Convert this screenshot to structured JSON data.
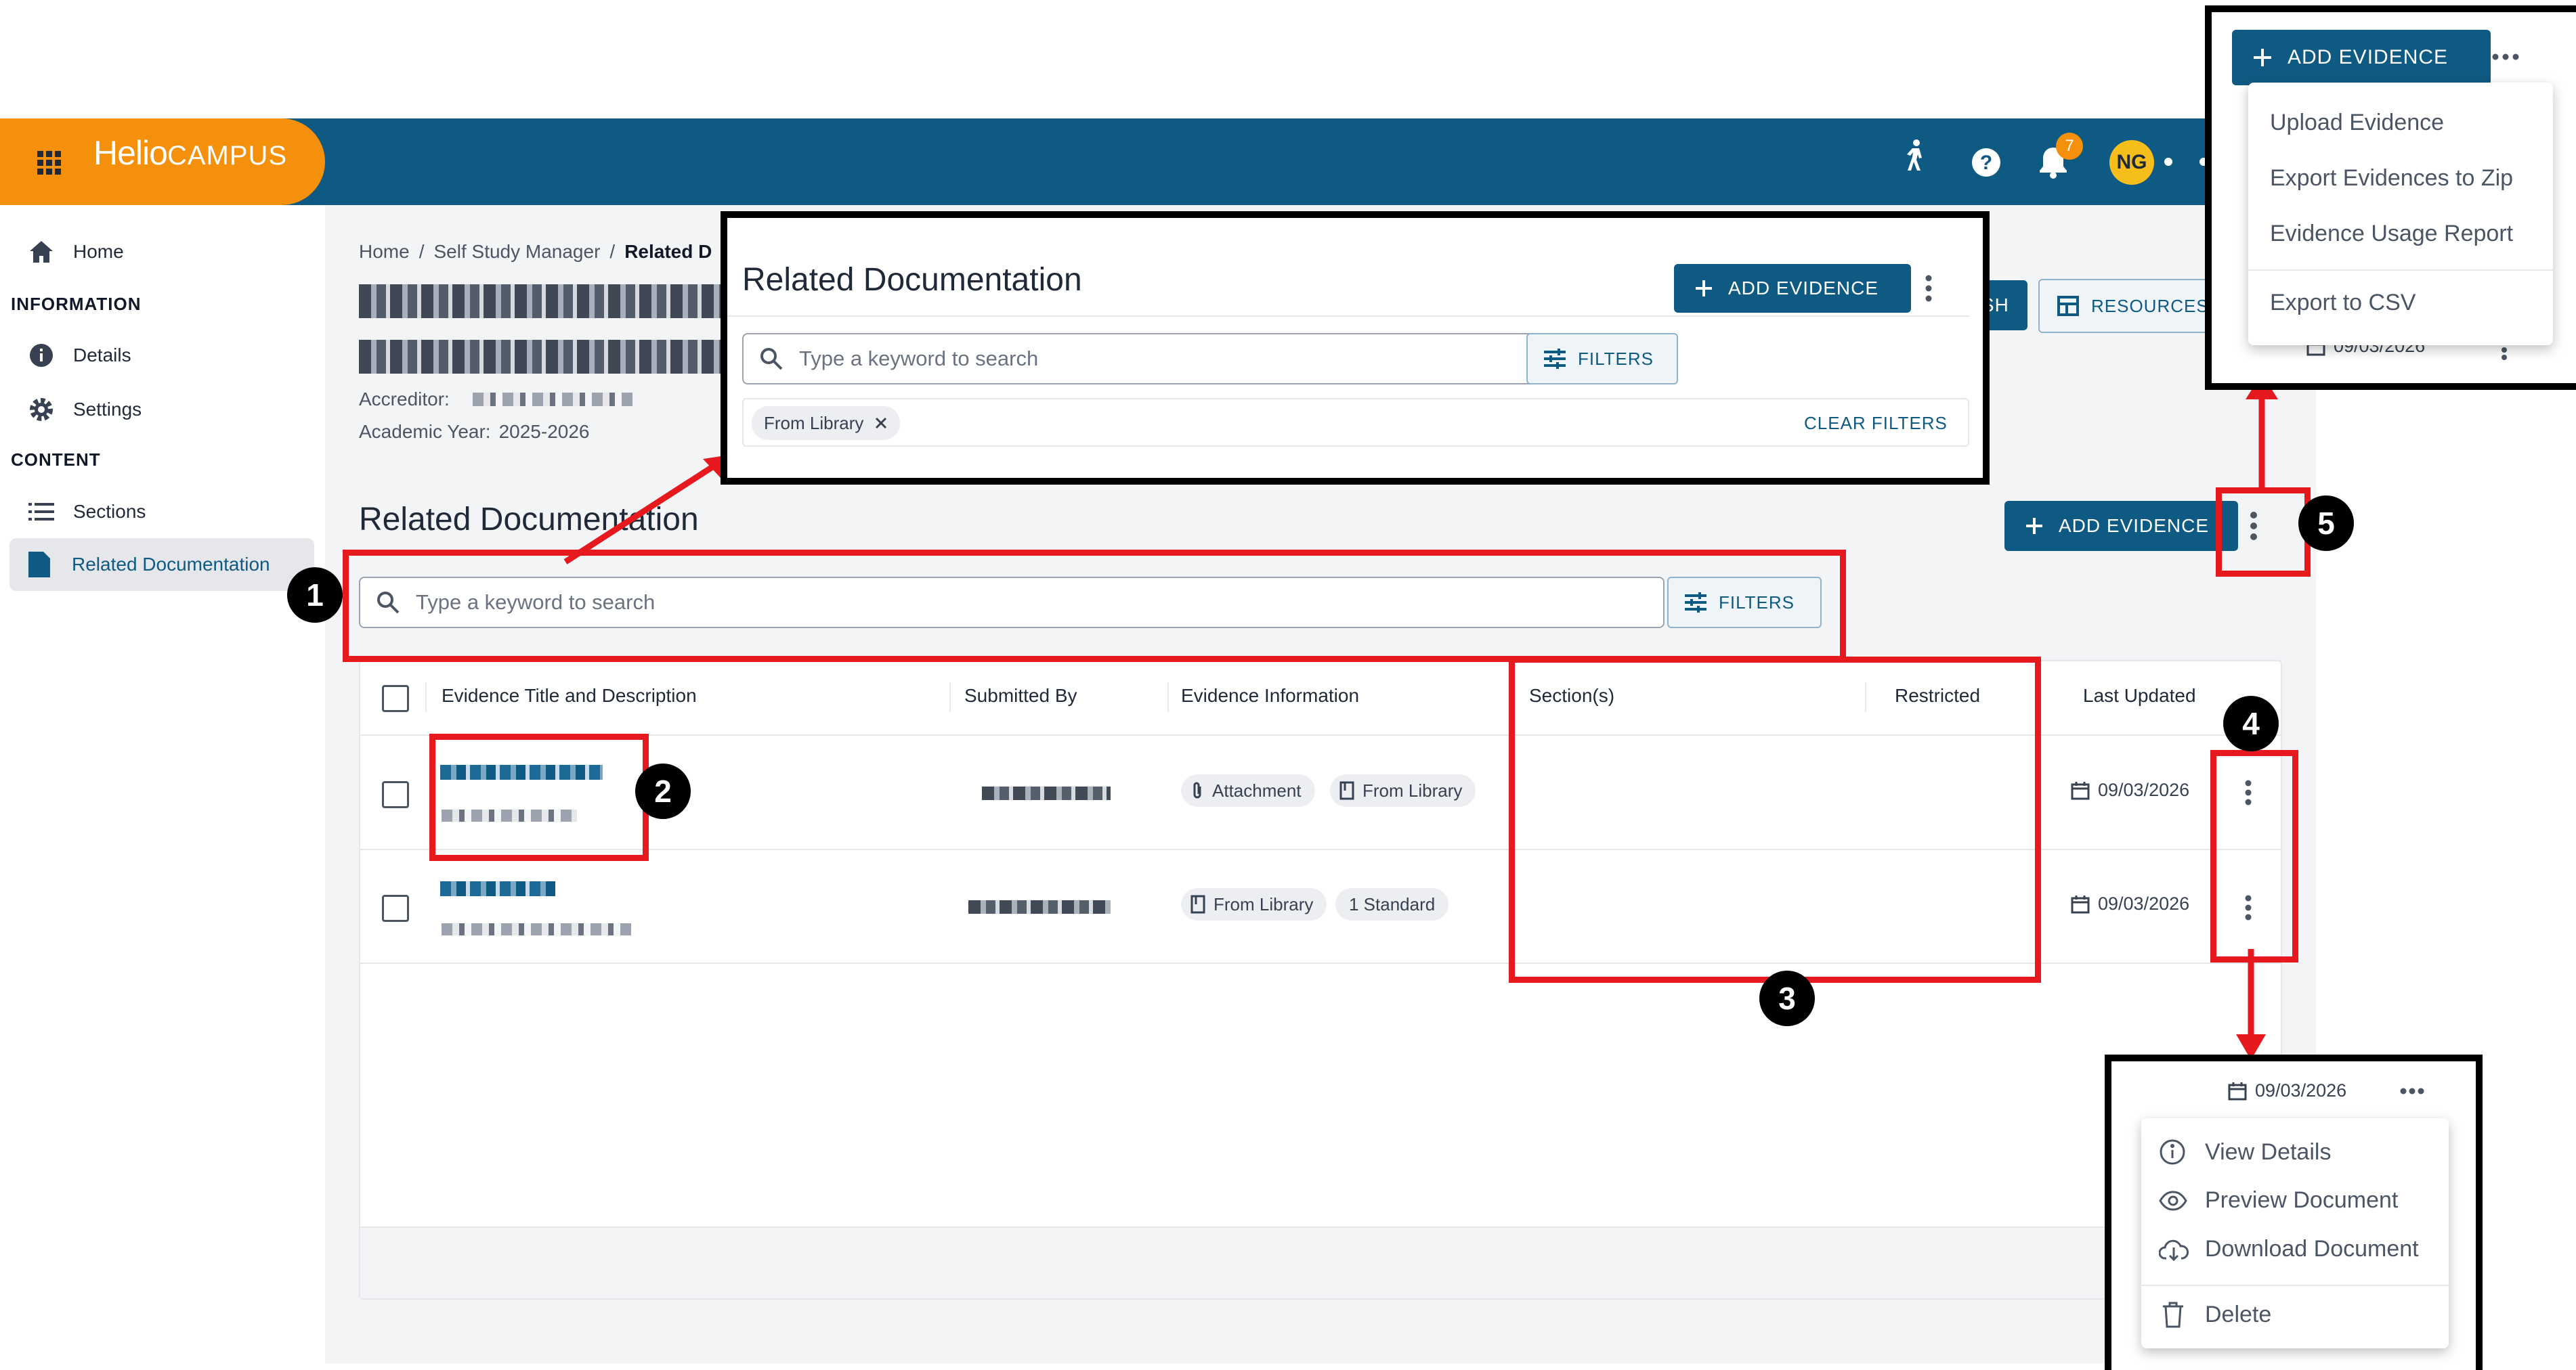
{
  "app": {
    "brand_main": "Helio",
    "brand_sub": "CAMPUS",
    "notification_count": "7",
    "avatar_initials": "NG"
  },
  "sidebar": {
    "home": "Home",
    "section_information": "INFORMATION",
    "details": "Details",
    "settings": "Settings",
    "section_content": "CONTENT",
    "sections": "Sections",
    "related_documentation": "Related Documentation"
  },
  "breadcrumb": {
    "home": "Home",
    "sep": "/",
    "self_study": "Self Study Manager",
    "current": "Related D"
  },
  "meta": {
    "accreditor_label": "Accreditor:",
    "academic_year_label": "Academic Year:",
    "academic_year_value": "2025-2026"
  },
  "header_buttons": {
    "publish_partial": "ISH",
    "resources": "RESOURCES"
  },
  "main": {
    "title": "Related Documentation",
    "add_evidence": "ADD EVIDENCE",
    "search_placeholder": "Type a keyword to search",
    "filters": "FILTERS"
  },
  "table": {
    "columns": [
      "Evidence Title and Description",
      "Submitted By",
      "Evidence Information",
      "Section(s)",
      "Restricted",
      "Last Updated"
    ],
    "rows": [
      {
        "chips": [
          "Attachment",
          "From Library"
        ],
        "last_updated": "09/03/2026"
      },
      {
        "chips": [
          "From Library",
          "1 Standard"
        ],
        "last_updated": "09/03/2026"
      }
    ]
  },
  "zoom_filters": {
    "title": "Related Documentation",
    "add_evidence": "ADD EVIDENCE",
    "search_placeholder": "Type a keyword to search",
    "filters": "FILTERS",
    "applied_chip": "From Library",
    "clear_filters": "CLEAR FILTERS"
  },
  "zoom_add_menu": {
    "add_evidence": "ADD EVIDENCE",
    "items": [
      "Upload Evidence",
      "Export Evidences to Zip",
      "Evidence Usage Report",
      "Export to CSV"
    ],
    "date": "09/03/2026"
  },
  "zoom_row_menu": {
    "date": "09/03/2026",
    "items": [
      "View Details",
      "Preview Document",
      "Download Document",
      "Delete"
    ]
  },
  "callouts": [
    "1",
    "2",
    "3",
    "4",
    "5"
  ],
  "colors": {
    "primary": "#0f5a82",
    "brand_orange": "#f5900d",
    "callout_red": "#e6191e",
    "avatar_yellow": "#f6be1a"
  }
}
